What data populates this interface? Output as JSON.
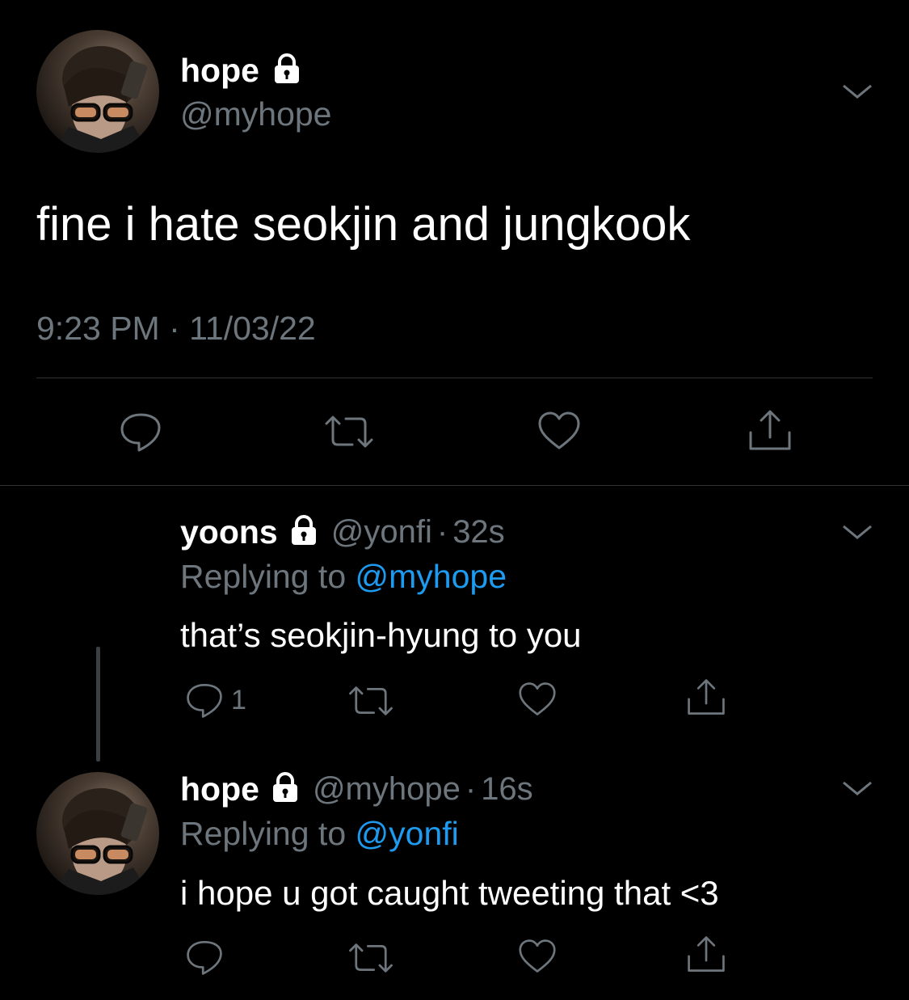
{
  "main_tweet": {
    "display_name": "hope",
    "handle": "@myhope",
    "text": "fine i hate seokjin and jungkook",
    "time": "9:23 PM",
    "separator": "·",
    "date": "11/03/22",
    "icons": [
      "lock-icon",
      "chevron-down-icon",
      "reply-icon",
      "retweet-icon",
      "like-icon",
      "share-icon"
    ]
  },
  "replies": [
    {
      "display_name": "yoons",
      "handle": "@yonfi",
      "separator": "·",
      "age": "32s",
      "replying_prefix": "Replying to",
      "replying_to": "@myhope",
      "text": "that’s seokjin-hyung to you",
      "reply_count": "1"
    },
    {
      "display_name": "hope",
      "handle": "@myhope",
      "separator": "·",
      "age": "16s",
      "replying_prefix": "Replying to",
      "replying_to": "@yonfi",
      "text": "i hope u got caught tweeting that <3",
      "reply_count": ""
    }
  ],
  "colors": {
    "background": "#000000",
    "text": "#ffffff",
    "muted": "#6e767d",
    "link": "#1d9bf0",
    "divider": "#2f3336"
  }
}
